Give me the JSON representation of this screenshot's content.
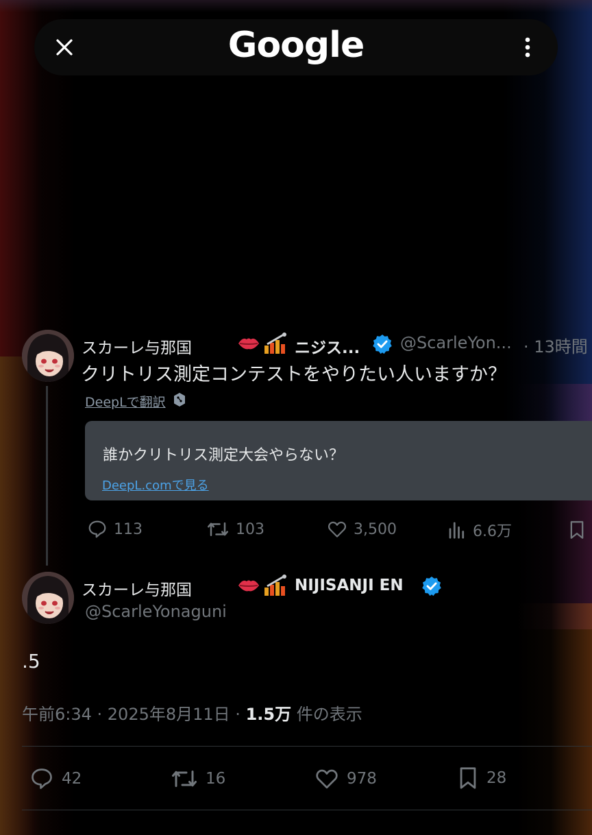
{
  "browser": {
    "logo_text": "Google"
  },
  "reply_tweet": {
    "display_name": "スカーレ与那国",
    "org_name": "ニジス...",
    "handle": "@ScarleYon...",
    "time": "· 13時間",
    "text": "クリトリス測定コンテストをやりたい人いますか？",
    "translate_link": "DeepLで翻訳",
    "translation": "誰かクリトリス測定大会やらない？",
    "translation_source_link": "DeepL.comで見る",
    "stats": {
      "replies": "113",
      "retweets": "103",
      "likes": "3,500",
      "views": "6.6万"
    }
  },
  "main_tweet": {
    "display_name": "スカーレ与那国",
    "org_name": "NIJISANJI EN",
    "handle": "@ScarleYonaguni",
    "text": ".5",
    "timestamp": "午前6:34 · 2025年8月11日 ·",
    "views_count": "1.5万",
    "views_label": "件の表示",
    "stats": {
      "replies": "42",
      "retweets": "16",
      "likes": "978",
      "bookmarks": "28"
    }
  },
  "colors": {
    "verified": "#1d9bf0",
    "translate_box": "#3c4147",
    "link_blue": "#4ca3e8"
  }
}
